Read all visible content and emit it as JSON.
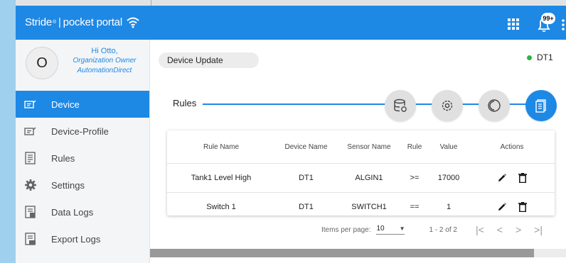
{
  "app": {
    "brand": "Stride",
    "separator": "|",
    "portal": "pocket portal"
  },
  "notifications": {
    "badge": "99+"
  },
  "profile": {
    "initial": "O",
    "greeting": "Hi Otto,",
    "role": "Organization Owner",
    "org": "AutomationDirect"
  },
  "sidebar": {
    "items": [
      {
        "label": "Device",
        "icon": "device-icon",
        "active": true
      },
      {
        "label": "Device-Profile",
        "icon": "device-profile-icon",
        "active": false
      },
      {
        "label": "Rules",
        "icon": "rules-icon",
        "active": false
      },
      {
        "label": "Settings",
        "icon": "gear-icon",
        "active": false
      },
      {
        "label": "Data Logs",
        "icon": "data-logs-icon",
        "active": false
      },
      {
        "label": "Export Logs",
        "icon": "export-logs-icon",
        "active": false
      }
    ]
  },
  "main": {
    "chip": "Device Update",
    "device_status": {
      "name": "DT1",
      "color": "#2db34a"
    },
    "section_title": "Rules",
    "table": {
      "columns": [
        "Rule Name",
        "Device Name",
        "Sensor Name",
        "Rule",
        "Value",
        "Actions"
      ],
      "rows": [
        {
          "rule_name": "Tank1 Level High",
          "device": "DT1",
          "sensor": "ALGIN1",
          "rule": ">=",
          "value": "17000"
        },
        {
          "rule_name": "Switch 1",
          "device": "DT1",
          "sensor": "SWITCH1",
          "rule": "==",
          "value": "1"
        }
      ]
    },
    "pagination": {
      "label": "Items per page:",
      "per_page": "10",
      "range": "1 - 2 of 2"
    }
  },
  "colors": {
    "accent": "#1e88e5",
    "online": "#2db34a"
  }
}
